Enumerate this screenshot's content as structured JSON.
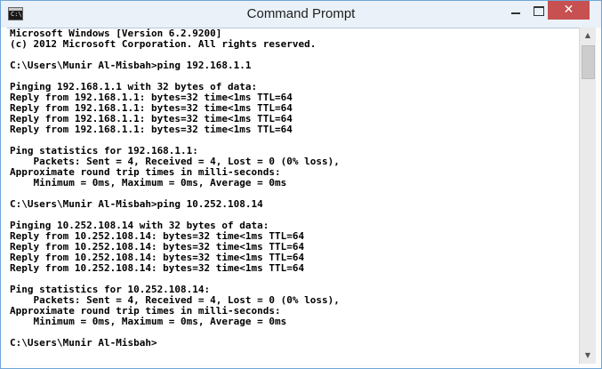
{
  "window": {
    "title": "Command Prompt"
  },
  "app_icon": {
    "glyph": "C:\\"
  },
  "controls": {
    "close_glyph": "✕"
  },
  "console_lines": [
    "Microsoft Windows [Version 6.2.9200]",
    "(c) 2012 Microsoft Corporation. All rights reserved.",
    "",
    "C:\\Users\\Munir Al-Misbah>ping 192.168.1.1",
    "",
    "Pinging 192.168.1.1 with 32 bytes of data:",
    "Reply from 192.168.1.1: bytes=32 time<1ms TTL=64",
    "Reply from 192.168.1.1: bytes=32 time<1ms TTL=64",
    "Reply from 192.168.1.1: bytes=32 time<1ms TTL=64",
    "Reply from 192.168.1.1: bytes=32 time<1ms TTL=64",
    "",
    "Ping statistics for 192.168.1.1:",
    "    Packets: Sent = 4, Received = 4, Lost = 0 (0% loss),",
    "Approximate round trip times in milli-seconds:",
    "    Minimum = 0ms, Maximum = 0ms, Average = 0ms",
    "",
    "C:\\Users\\Munir Al-Misbah>ping 10.252.108.14",
    "",
    "Pinging 10.252.108.14 with 32 bytes of data:",
    "Reply from 10.252.108.14: bytes=32 time<1ms TTL=64",
    "Reply from 10.252.108.14: bytes=32 time<1ms TTL=64",
    "Reply from 10.252.108.14: bytes=32 time<1ms TTL=64",
    "Reply from 10.252.108.14: bytes=32 time<1ms TTL=64",
    "",
    "Ping statistics for 10.252.108.14:",
    "    Packets: Sent = 4, Received = 4, Lost = 0 (0% loss),",
    "Approximate round trip times in milli-seconds:",
    "    Minimum = 0ms, Maximum = 0ms, Average = 0ms",
    "",
    "C:\\Users\\Munir Al-Misbah>"
  ],
  "icons": {
    "app": "cmd-icon",
    "minimize": "minimize-icon",
    "maximize": "maximize-icon",
    "close": "close-icon",
    "scroll_up": "triangle-up-icon",
    "scroll_down": "triangle-down-icon"
  },
  "colors": {
    "titlebar": "#eaf1f8",
    "frame": "#6fa6d8",
    "close_button": "#c75050",
    "console_bg": "#ffffff",
    "console_text": "#000000"
  }
}
